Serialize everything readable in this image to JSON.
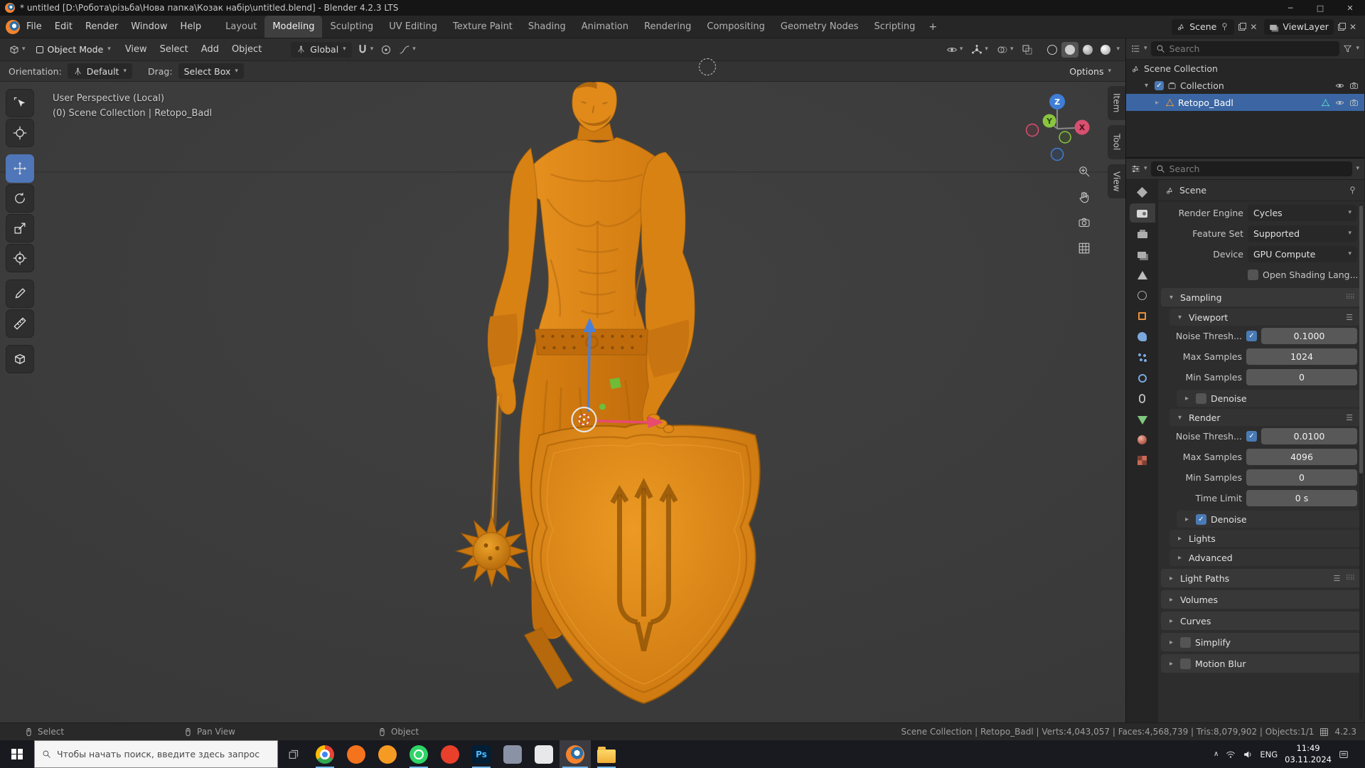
{
  "colors": {
    "accent": "#4772b3",
    "selection": "#3b66a3",
    "model_orange": "#e08818",
    "axis_x": "#d85070",
    "axis_y": "#8bc53f",
    "axis_z": "#3f7dd6"
  },
  "window": {
    "title": "* untitled [D:\\Робота\\різьба\\Нова папка\\Козак набір\\untitled.blend] - Blender 4.2.3 LTS"
  },
  "topbar": {
    "menus": [
      {
        "label": "File"
      },
      {
        "label": "Edit"
      },
      {
        "label": "Render"
      },
      {
        "label": "Window"
      },
      {
        "label": "Help"
      }
    ],
    "workspaces": [
      {
        "label": "Layout"
      },
      {
        "label": "Modeling",
        "active": true
      },
      {
        "label": "Sculpting"
      },
      {
        "label": "UV Editing"
      },
      {
        "label": "Texture Paint"
      },
      {
        "label": "Shading"
      },
      {
        "label": "Animation"
      },
      {
        "label": "Rendering"
      },
      {
        "label": "Compositing"
      },
      {
        "label": "Geometry Nodes"
      },
      {
        "label": "Scripting"
      }
    ],
    "add_workspace": "+",
    "scene": {
      "label": "Scene"
    },
    "view_layer": {
      "label": "ViewLayer"
    }
  },
  "viewport_header": {
    "mode": "Object Mode",
    "menus": [
      {
        "label": "View"
      },
      {
        "label": "Select"
      },
      {
        "label": "Add"
      },
      {
        "label": "Object"
      }
    ],
    "orientation": "Global",
    "icons_mid": [
      {
        "name": "snapping",
        "icon": "i-magnet",
        "chev": true
      },
      {
        "name": "proportional-edit",
        "icon": "i-propcircle"
      },
      {
        "name": "proportional-falloff",
        "icon": "i-falloff",
        "chev": true
      }
    ],
    "icons_right": [
      {
        "name": "show-visibility",
        "icon": "i-eye",
        "chev": true
      },
      {
        "name": "show-gizmos",
        "icon": "i-gizmoicon",
        "chev": true
      },
      {
        "name": "show-overlays",
        "icon": "i-overlay",
        "chev": true
      },
      {
        "name": "toggle-xray",
        "icon": "i-xray"
      }
    ],
    "shading_modes": [
      {
        "name": "wireframe"
      },
      {
        "name": "solid",
        "active": true
      },
      {
        "name": "material"
      },
      {
        "name": "rendered"
      }
    ]
  },
  "tool_settings": {
    "orientation_label": "Orientation:",
    "orientation_value": "Default",
    "drag_label": "Drag:",
    "drag_value": "Select Box",
    "options": "Options"
  },
  "viewport": {
    "overlay_line1": "User Perspective (Local)",
    "overlay_line2": "(0) Scene Collection | Retopo_Badl",
    "axis": {
      "x": "X",
      "y": "Y",
      "z": "Z"
    },
    "n_tabs": [
      {
        "label": "Item"
      },
      {
        "label": "Tool"
      },
      {
        "label": "View"
      }
    ],
    "tools": [
      {
        "name": "tweak-select",
        "icon": "i-select"
      },
      {
        "name": "cursor",
        "icon": "i-cursor"
      },
      {
        "name": "move",
        "icon": "i-move",
        "active": true,
        "gap": true
      },
      {
        "name": "rotate",
        "icon": "i-rotate"
      },
      {
        "name": "scale",
        "icon": "i-scale"
      },
      {
        "name": "transform",
        "icon": "i-transform"
      },
      {
        "name": "annotate",
        "icon": "i-annotate",
        "gap": true
      },
      {
        "name": "measure",
        "icon": "i-measure"
      },
      {
        "name": "add-cube",
        "icon": "i-addcube",
        "gap": true
      }
    ],
    "side_buttons": [
      {
        "name": "zoom",
        "icon": "i-zoom"
      },
      {
        "name": "pan",
        "icon": "i-hand"
      },
      {
        "name": "camera-view",
        "icon": "i-photocam"
      },
      {
        "name": "toggle-perspective",
        "icon": "i-grid"
      }
    ]
  },
  "outliner": {
    "search_placeholder": "Search",
    "rows": [
      {
        "label": "Scene Collection",
        "icon": "scene",
        "depth": 0
      },
      {
        "label": "Collection",
        "icon": "collection",
        "depth": 1,
        "arrow": "down",
        "checkbox": true,
        "eye": true,
        "camera": true
      },
      {
        "label": "Retopo_Badl",
        "icon": "mesh",
        "depth": 2,
        "arrow": "right",
        "data_icon": true,
        "eye": true,
        "camera": true,
        "selected": true
      }
    ]
  },
  "properties": {
    "search_placeholder": "Search",
    "breadcrumb": "Scene",
    "tabs": [
      {
        "name": "tool",
        "shape": "tool"
      },
      {
        "name": "render",
        "shape": "camera",
        "active": true
      },
      {
        "name": "output",
        "shape": "printer"
      },
      {
        "name": "view-layer",
        "shape": "photos"
      },
      {
        "name": "scene",
        "shape": "scene"
      },
      {
        "name": "world",
        "shape": "globe"
      },
      {
        "name": "object",
        "shape": "square-orange"
      },
      {
        "name": "modifiers",
        "shape": "wrench"
      },
      {
        "name": "particles",
        "shape": "particles"
      },
      {
        "name": "physics",
        "shape": "physics"
      },
      {
        "name": "constraints",
        "shape": "constraint"
      },
      {
        "name": "object-data",
        "shape": "triangle-green"
      },
      {
        "name": "material",
        "shape": "sphere-red"
      },
      {
        "name": "texture",
        "shape": "checker-red"
      }
    ],
    "rows": [
      {
        "type": "select",
        "label": "Render Engine",
        "value": "Cycles",
        "indent": 0
      },
      {
        "type": "select",
        "label": "Feature Set",
        "value": "Supported",
        "indent": 0
      },
      {
        "type": "select",
        "label": "Device",
        "value": "GPU Compute",
        "indent": 0
      },
      {
        "type": "checklabel",
        "label": "Open Shading Lang...",
        "checked": false,
        "indent": 0
      },
      {
        "type": "section",
        "label": "Sampling",
        "expanded": true,
        "grip": true
      },
      {
        "type": "subheader",
        "label": "Viewport",
        "expanded": true,
        "preset": true,
        "indent": 1
      },
      {
        "type": "checknumber",
        "label": "Noise Thresh...",
        "checked": true,
        "value": "0.1000",
        "indent": 1
      },
      {
        "type": "number",
        "label": "Max Samples",
        "value": "1024",
        "indent": 1
      },
      {
        "type": "number",
        "label": "Min Samples",
        "value": "0",
        "indent": 1
      },
      {
        "type": "collapsecheck",
        "label": "Denoise",
        "checked": false,
        "indent": 2
      },
      {
        "type": "subheader",
        "label": "Render",
        "expanded": true,
        "preset": true,
        "indent": 1
      },
      {
        "type": "checknumber",
        "label": "Noise Thresh...",
        "checked": true,
        "value": "0.0100",
        "indent": 1
      },
      {
        "type": "number",
        "label": "Max Samples",
        "value": "4096",
        "indent": 1
      },
      {
        "type": "number",
        "label": "Min Samples",
        "value": "0",
        "indent": 1
      },
      {
        "type": "number",
        "label": "Time Limit",
        "value": "0 s",
        "indent": 1
      },
      {
        "type": "collapsecheck",
        "label": "Denoise",
        "checked": true,
        "indent": 2
      },
      {
        "type": "collapse",
        "label": "Lights",
        "indent": 1
      },
      {
        "type": "collapse",
        "label": "Advanced",
        "indent": 1
      },
      {
        "type": "section",
        "label": "Light Paths",
        "expanded": false,
        "preset": true,
        "grip": true
      },
      {
        "type": "section",
        "label": "Volumes",
        "expanded": false
      },
      {
        "type": "section",
        "label": "Curves",
        "expanded": false
      },
      {
        "type": "section",
        "label": "Simplify",
        "expanded": false,
        "checkbox": true,
        "checked": false
      },
      {
        "type": "section",
        "label": "Motion Blur",
        "expanded": false,
        "checkbox": true,
        "checked": false
      }
    ]
  },
  "status_bar": {
    "hints": [
      {
        "label": "Select"
      },
      {
        "label": "Pan View"
      },
      {
        "label": "Object"
      }
    ],
    "info": "Scene Collection | Retopo_Badl | Verts:4,043,057 | Faces:4,568,739 | Tris:8,079,902 | Objects:1/1",
    "version": "4.2.3"
  },
  "taskbar": {
    "search_placeholder": "Чтобы начать поиск, введите здесь запрос",
    "apps": [
      {
        "name": "chrome",
        "kind": "chrome",
        "running": true
      },
      {
        "name": "app-orange",
        "kind": "dot",
        "color": "#f4731c"
      },
      {
        "name": "app-amber",
        "kind": "dot",
        "color": "#f59a23"
      },
      {
        "name": "whatsapp",
        "kind": "dot2",
        "color": "#2fd566",
        "running": true
      },
      {
        "name": "app-red",
        "kind": "dot",
        "color": "#e8402a"
      },
      {
        "name": "photoshop",
        "kind": "ps",
        "label": "Ps",
        "running": true
      },
      {
        "name": "app-gray",
        "kind": "sq",
        "color": "#8a93a5"
      },
      {
        "name": "xp-pen",
        "kind": "sq",
        "color": "#e8e8ea"
      },
      {
        "name": "blender",
        "kind": "blender",
        "active": true,
        "running": true
      },
      {
        "name": "explorer",
        "kind": "folder",
        "running": true
      }
    ],
    "tray": {
      "lang": "ENG",
      "time": "11:49",
      "date": "03.11.2024"
    }
  }
}
